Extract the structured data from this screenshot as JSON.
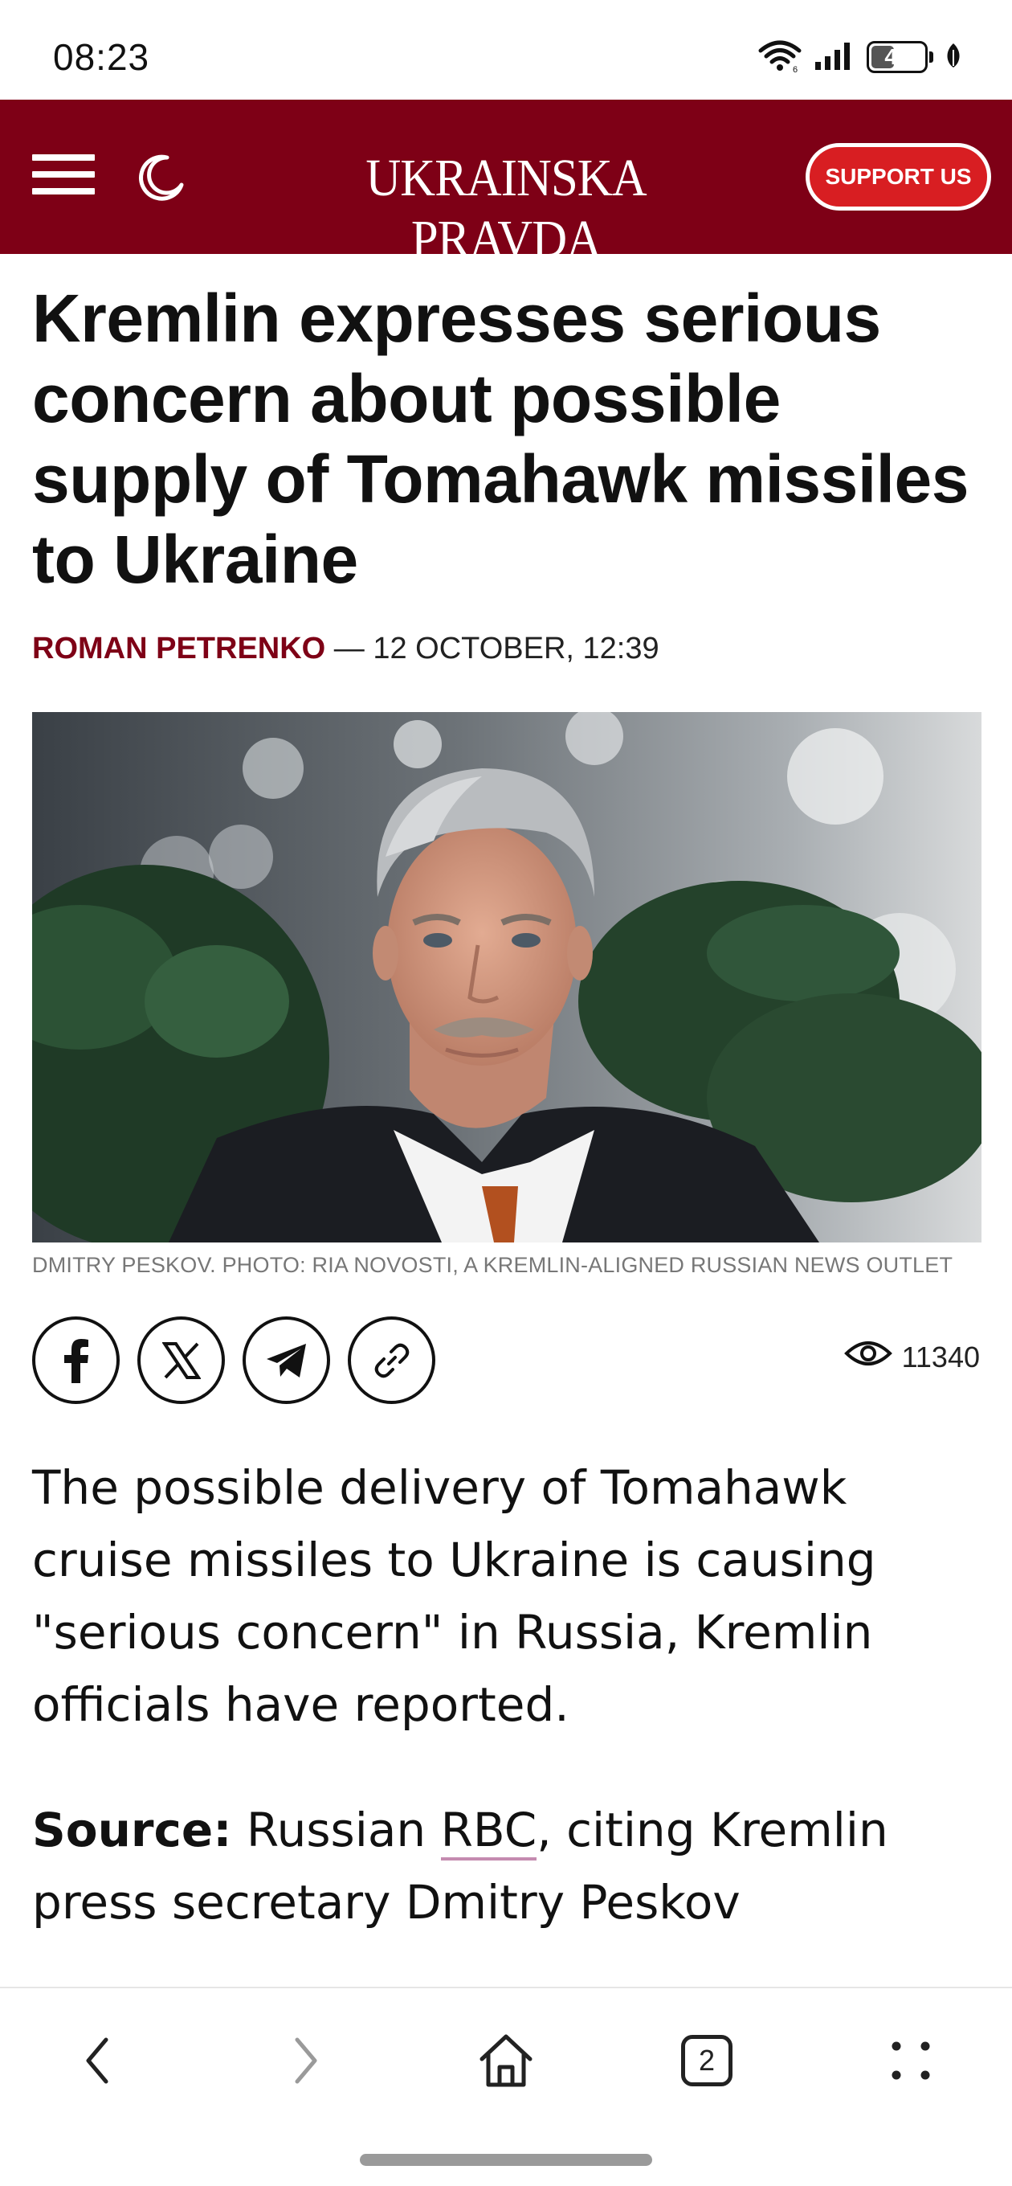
{
  "status_bar": {
    "time": "08:23",
    "battery_level": "44",
    "icons": [
      "wifi-icon",
      "signal-icon",
      "battery-icon",
      "leaf-icon"
    ]
  },
  "header": {
    "logo": "UKRAINSKA PRAVDA",
    "support_label": "SUPPORT US",
    "icons": [
      "menu-icon",
      "moon-icon"
    ],
    "colors": {
      "brand": "#7e0016",
      "support": "#d81e22"
    }
  },
  "article": {
    "headline": "Kremlin expresses serious concern about possible supply of Tomahawk missiles to Ukraine",
    "author": "ROMAN PETRENKO",
    "dateline": " — 12 OCTOBER, 12:39",
    "photo_caption": "DMITRY PESKOV. PHOTO: RIA NOVOSTI, A KREMLIN-ALIGNED RUSSIAN NEWS OUTLET",
    "share_icons": [
      "facebook-icon",
      "x-icon",
      "telegram-icon",
      "link-icon"
    ],
    "views": "11340",
    "paragraph_1": "The possible delivery of Tomahawk cruise missiles to Ukraine is causing \"serious concern\" in Russia, Kremlin officials have reported.",
    "source_label": "Source:",
    "source_pre": " Russian ",
    "source_link": "RBC",
    "source_post": ", citing Kremlin press secretary Dmitry Peskov"
  },
  "bottom_nav": {
    "tab_count": "2",
    "icons": [
      "back-icon",
      "forward-icon",
      "home-icon",
      "tabs-icon",
      "more-icon"
    ]
  }
}
